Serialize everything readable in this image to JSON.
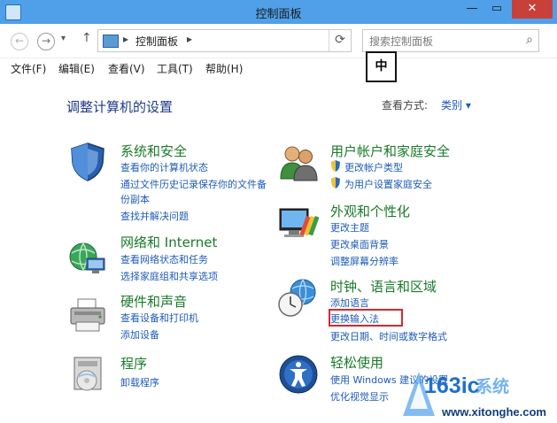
{
  "window": {
    "title": "控制面板",
    "minimize_label": "—",
    "maximize_label": "▭",
    "close_label": "✕"
  },
  "nav": {
    "back_glyph": "←",
    "forward_glyph": "→",
    "history_glyph": "▾",
    "up_glyph": "↑",
    "breadcrumb_root_sep": "▸",
    "breadcrumb": "控制面板",
    "breadcrumb_sep": "▸",
    "refresh_glyph": "⟳",
    "search_placeholder": "搜索控制面板"
  },
  "ime_indicator": "中",
  "menu": [
    "文件(F)",
    "编辑(E)",
    "查看(V)",
    "工具(T)",
    "帮助(H)"
  ],
  "main": {
    "heading": "调整计算机的设置",
    "view_by_label": "查看方式:",
    "view_by_value": "类别 ▾"
  },
  "categories_left": [
    {
      "title": "系统和安全",
      "icon": "shield-icon",
      "tasks": [
        "查看你的计算机状态",
        "通过文件历史记录保存你的文件备份副本",
        "查找并解决问题"
      ]
    },
    {
      "title": "网络和 Internet",
      "icon": "network-globe-icon",
      "tasks": [
        "查看网络状态和任务",
        "选择家庭组和共享选项"
      ]
    },
    {
      "title": "硬件和声音",
      "icon": "printer-icon",
      "tasks": [
        "查看设备和打印机",
        "添加设备"
      ]
    },
    {
      "title": "程序",
      "icon": "programs-icon",
      "tasks": [
        "卸载程序"
      ]
    }
  ],
  "categories_right": [
    {
      "title": "用户帐户和家庭安全",
      "icon": "users-icon",
      "tasks": [
        "更改帐户类型",
        "为用户设置家庭安全"
      ]
    },
    {
      "title": "外观和个性化",
      "icon": "monitor-palette-icon",
      "tasks": [
        "更改主题",
        "更改桌面背景",
        "调整屏幕分辨率"
      ]
    },
    {
      "title": "时钟、语言和区域",
      "icon": "clock-globe-icon",
      "tasks": [
        "添加语言",
        "更换输入法",
        "更改日期、时间或数字格式"
      ]
    },
    {
      "title": "轻松使用",
      "icon": "ease-of-access-icon",
      "tasks": [
        "使用 Windows 建议的设置",
        "优化视觉显示"
      ]
    }
  ],
  "watermark": {
    "text1": "163ic",
    "text2": "系统",
    "text3": "www.xitonghe.com"
  },
  "colors": {
    "title_bar": "#4fa0e8",
    "link": "#1e5bb8",
    "category_title": "#1a7a2a",
    "highlight": "#d9262c"
  }
}
